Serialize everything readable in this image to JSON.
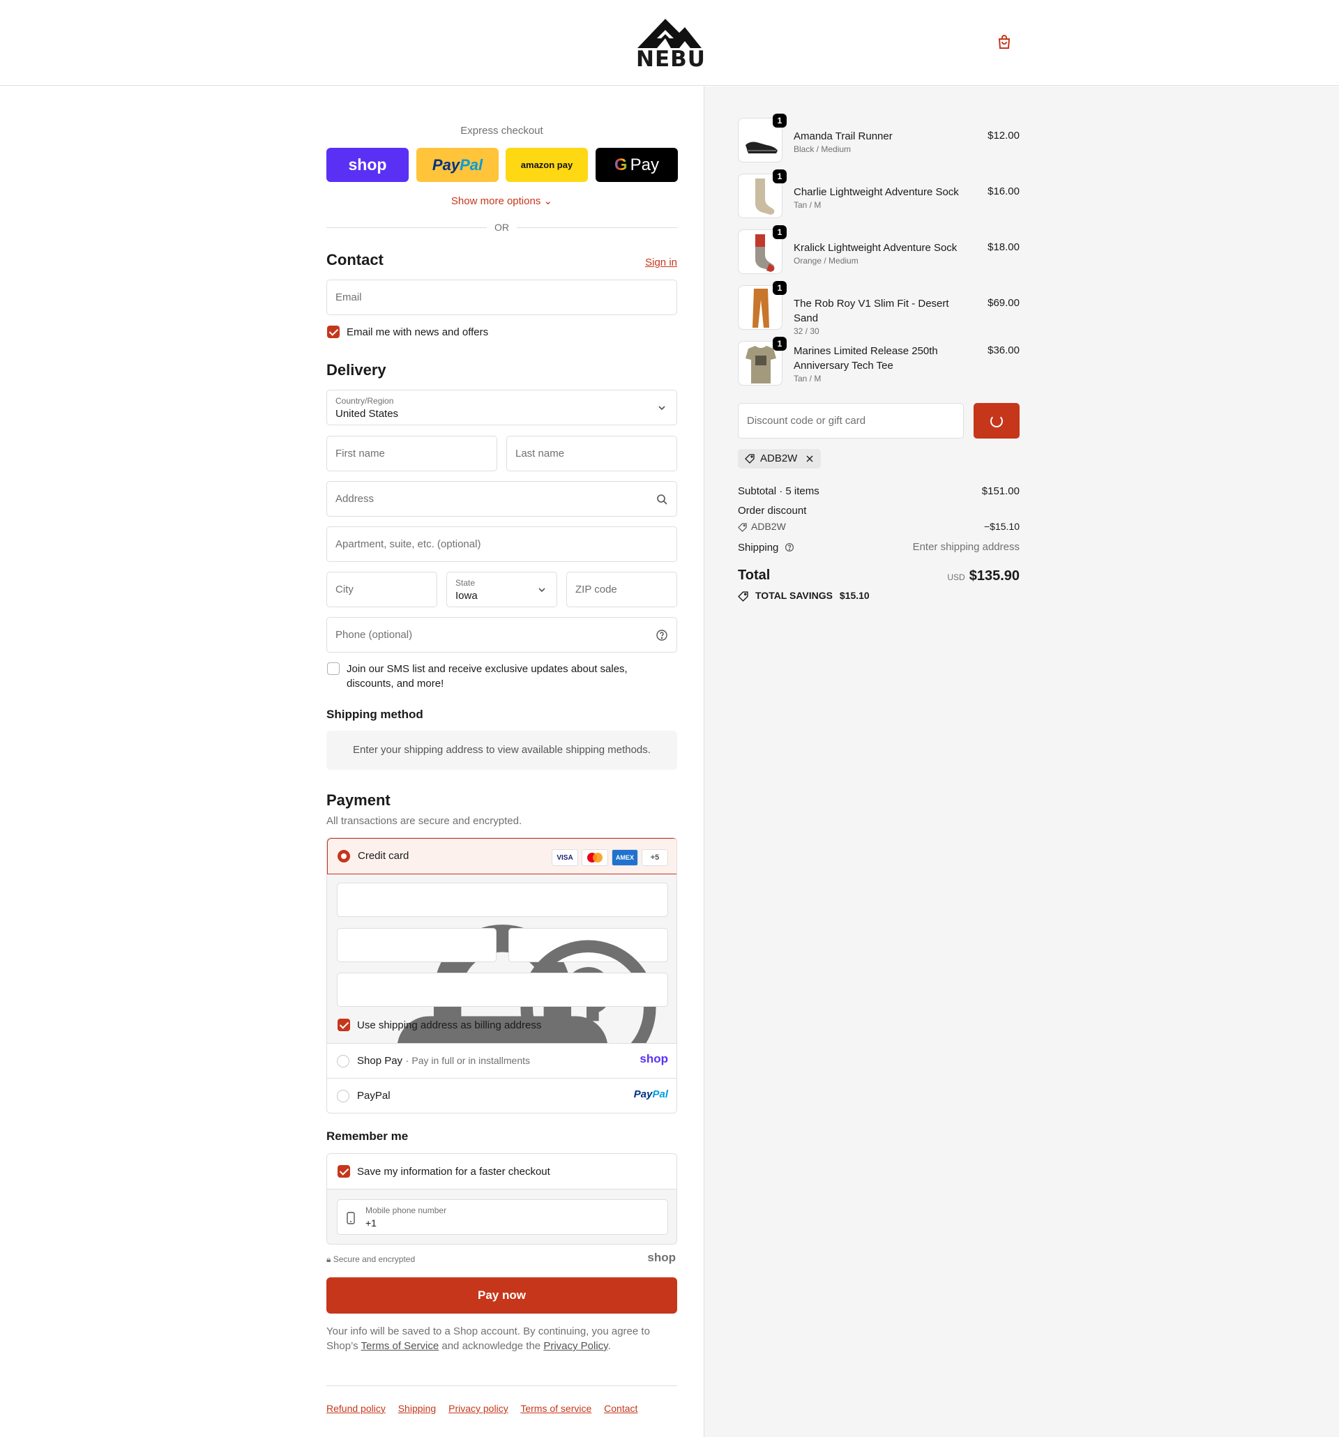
{
  "brand": {
    "logo_text": "NEBU",
    "accent_color": "#c6361b",
    "cart_icon": "shopping-bag-icon"
  },
  "express": {
    "title": "Express checkout",
    "shop_label": "shop",
    "paypal_label_1": "Pay",
    "paypal_label_2": "Pal",
    "amazon_label": "amazon pay",
    "gpay_g": "G",
    "gpay_label": "Pay",
    "more_options": "Show more options",
    "or": "OR"
  },
  "contact": {
    "title": "Contact",
    "sign_in": "Sign in",
    "email_placeholder": "Email",
    "news_label": "Email me with news and offers",
    "news_checked": true
  },
  "delivery": {
    "title": "Delivery",
    "country_label": "Country/Region",
    "country_value": "United States",
    "first_name_placeholder": "First name",
    "last_name_placeholder": "Last name",
    "address_placeholder": "Address",
    "apartment_placeholder": "Apartment, suite, etc. (optional)",
    "city_placeholder": "City",
    "state_label": "State",
    "state_value": "Iowa",
    "zip_placeholder": "ZIP code",
    "phone_placeholder": "Phone (optional)",
    "sms_label": "Join our SMS list and receive exclusive updates about sales, discounts, and more!",
    "sms_checked": false
  },
  "shipping_method": {
    "title": "Shipping method",
    "empty_message": "Enter your shipping address to view available shipping methods."
  },
  "payment": {
    "title": "Payment",
    "subtitle": "All transactions are secure and encrypted.",
    "credit_card_label": "Credit card",
    "card_logos": [
      "VISA",
      "MC",
      "AMEX",
      "+5"
    ],
    "billing_label": "Use shipping address as billing address",
    "billing_checked": true,
    "shop_pay_label": "Shop Pay",
    "shop_pay_sub": "Pay in full or in installments",
    "shop_pay_logo": "shop",
    "paypal_label": "PayPal",
    "paypal_logo_1": "Pay",
    "paypal_logo_2": "Pal"
  },
  "remember": {
    "title": "Remember me",
    "save_label": "Save my information for a faster checkout",
    "save_checked": true,
    "phone_label": "Mobile phone number",
    "phone_value": "+1",
    "secure_text": "Secure and encrypted",
    "shop_logo": "shop"
  },
  "pay_now": "Pay now",
  "legal": {
    "text_1": "Your info will be saved to a Shop account. By continuing, you agree to Shop’s ",
    "terms": "Terms of Service",
    "text_2": " and acknowledge the ",
    "privacy": "Privacy Policy",
    "text_3": "."
  },
  "footer": {
    "links": [
      "Refund policy",
      "Shipping",
      "Privacy policy",
      "Terms of service",
      "Contact"
    ]
  },
  "cart": {
    "items": [
      {
        "name": "Amanda Trail Runner",
        "variant": "Black / Medium",
        "price": "$12.00",
        "qty": "1"
      },
      {
        "name": "Charlie Lightweight Adventure Sock",
        "variant": "Tan / M",
        "price": "$16.00",
        "qty": "1"
      },
      {
        "name": "Kralick Lightweight Adventure Sock",
        "variant": "Orange / Medium",
        "price": "$18.00",
        "qty": "1"
      },
      {
        "name": "The Rob Roy V1 Slim Fit - Desert Sand",
        "variant": "32 / 30",
        "price": "$69.00",
        "qty": "1"
      },
      {
        "name": "Marines Limited Release 250th Anniversary Tech Tee",
        "variant": "Tan / M",
        "price": "$36.00",
        "qty": "1"
      }
    ],
    "discount_placeholder": "Discount code or gift card",
    "applied_code": "ADB2W",
    "subtotal_label": "Subtotal · 5 items",
    "subtotal_value": "$151.00",
    "order_discount_label": "Order discount",
    "discount_code": "ADB2W",
    "discount_value": "−$15.10",
    "shipping_label": "Shipping",
    "shipping_value": "Enter shipping address",
    "total_label": "Total",
    "currency": "USD",
    "total_value": "$135.90",
    "savings_label": "TOTAL SAVINGS",
    "savings_value": "$15.10"
  }
}
